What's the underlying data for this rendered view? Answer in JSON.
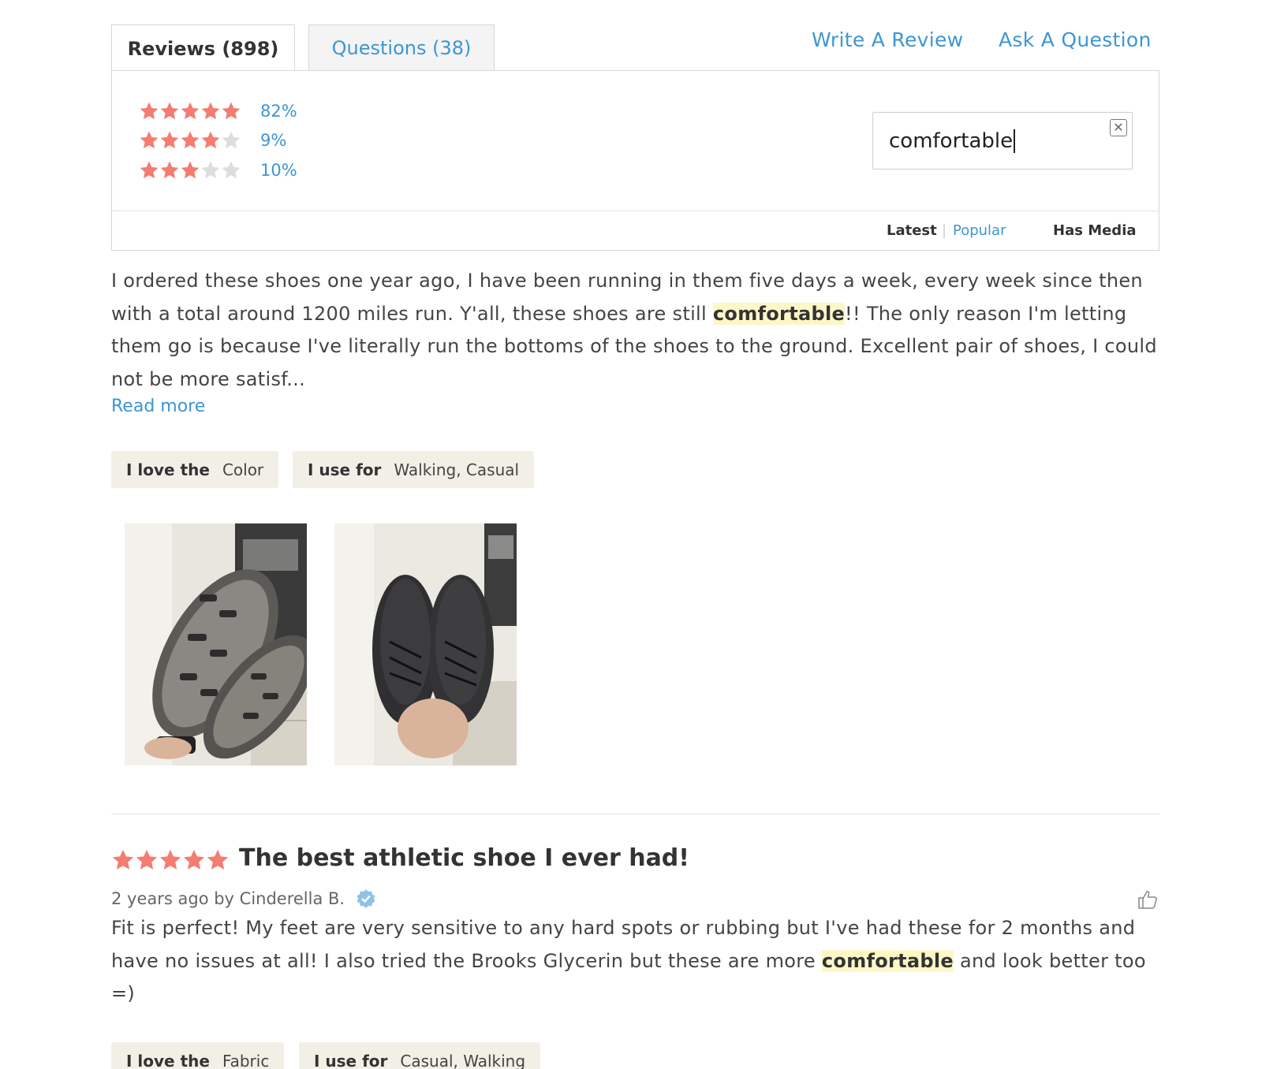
{
  "tabs": {
    "reviews_label": "Reviews (898)",
    "questions_label": "Questions (38)"
  },
  "actions": {
    "write_review": "Write A Review",
    "ask_question": "Ask A Question"
  },
  "ratings": [
    {
      "stars": 5,
      "percent": "82%"
    },
    {
      "stars": 4,
      "percent": "9%"
    },
    {
      "stars": 3,
      "percent": "10%"
    }
  ],
  "search": {
    "value": "comfortable",
    "clear_icon": "close-icon"
  },
  "sort": {
    "latest": "Latest",
    "separator": "|",
    "popular": "Popular",
    "has_media": "Has Media"
  },
  "review1": {
    "text_before": "I ordered these shoes one year ago, I have been running in them five days a week, every week since then with a total around 1200 miles run. Y'all, these shoes are still ",
    "highlight": "comfortable",
    "text_after": "!! The only reason I'm letting them go is because I've literally run the bottoms of the shoes to the ground. Excellent pair of shoes, I could not be more satisf...",
    "read_more": "Read more",
    "chips": [
      {
        "label": "I love the",
        "value": "Color"
      },
      {
        "label": "I use for",
        "value": "Walking, Casual"
      }
    ]
  },
  "review2": {
    "stars": 5,
    "title": "The best athletic shoe I ever had!",
    "meta": "2 years ago by Cinderella B.",
    "text_before": "Fit is perfect! My feet are very sensitive to any hard spots or rubbing but I've had these for 2 months and have no issues at all! I also tried the Brooks Glycerin but these are more ",
    "highlight": "comfortable",
    "text_after": " and look better too =)",
    "chips": [
      {
        "label": "I love the",
        "value": "Fabric"
      },
      {
        "label": "I use for",
        "value": "Casual, Walking"
      }
    ]
  },
  "colors": {
    "accent": "#3d96d4",
    "star_filled": "#f47c70",
    "star_empty": "#dddddd",
    "highlight": "#fdf7c8",
    "chip_bg": "#f2efe6"
  }
}
